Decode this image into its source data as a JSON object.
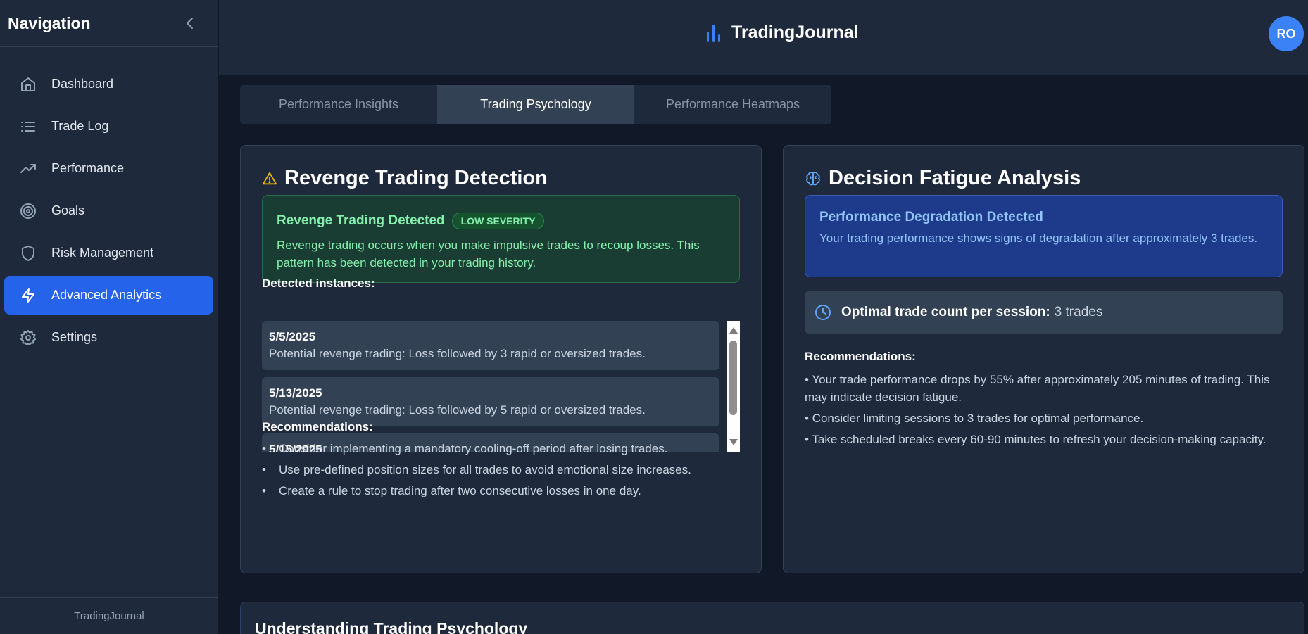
{
  "sidebar": {
    "title": "Navigation",
    "items": [
      {
        "label": "Dashboard",
        "icon": "home-icon"
      },
      {
        "label": "Trade Log",
        "icon": "list-icon"
      },
      {
        "label": "Performance",
        "icon": "trending-up-icon"
      },
      {
        "label": "Goals",
        "icon": "target-icon"
      },
      {
        "label": "Risk Management",
        "icon": "shield-icon"
      },
      {
        "label": "Advanced Analytics",
        "icon": "zap-icon",
        "active": true
      },
      {
        "label": "Settings",
        "icon": "gear-icon"
      }
    ],
    "footer": "TradingJournal"
  },
  "header": {
    "brand": "TradingJournal",
    "avatar_initials": "RO"
  },
  "tabs": [
    {
      "label": "Performance Insights"
    },
    {
      "label": "Trading Psychology",
      "active": true
    },
    {
      "label": "Performance Heatmaps"
    }
  ],
  "revenge": {
    "title": "Revenge Trading Detection",
    "alert": {
      "title": "Revenge Trading Detected",
      "badge": "LOW SEVERITY",
      "body": "Revenge trading occurs when you make impulsive trades to recoup losses. This pattern has been detected in your trading history."
    },
    "instances_label": "Detected instances:",
    "instances": [
      {
        "date": "5/5/2025",
        "text": "Potential revenge trading: Loss followed by 3 rapid or oversized trades."
      },
      {
        "date": "5/13/2025",
        "text": "Potential revenge trading: Loss followed by 5 rapid or oversized trades."
      },
      {
        "date": "5/15/2025",
        "text": ""
      }
    ],
    "recommendations_label": "Recommendations:",
    "recommendations": [
      "Consider implementing a mandatory cooling-off period after losing trades.",
      "Use pre-defined position sizes for all trades to avoid emotional size increases.",
      "Create a rule to stop trading after two consecutive losses in one day."
    ]
  },
  "fatigue": {
    "title": "Decision Fatigue Analysis",
    "alert": {
      "title": "Performance Degradation Detected",
      "body": "Your trading performance shows signs of degradation after approximately 3 trades."
    },
    "optimal_label": "Optimal trade count per session:",
    "optimal_value": "3 trades",
    "recommendations_label": "Recommendations:",
    "recommendations": [
      "•   Your trade performance drops by 55% after approximately 205 minutes of trading. This may indicate decision fatigue.",
      "•   Consider limiting sessions to 3 trades for optimal performance.",
      "•   Take scheduled breaks every 60-90 minutes to refresh your decision-making capacity."
    ]
  },
  "understanding": {
    "title": "Understanding Trading Psychology"
  },
  "colors": {
    "accent": "#2563eb",
    "success": "#86efac",
    "info": "#93c5fd",
    "warning": "#eab308"
  }
}
